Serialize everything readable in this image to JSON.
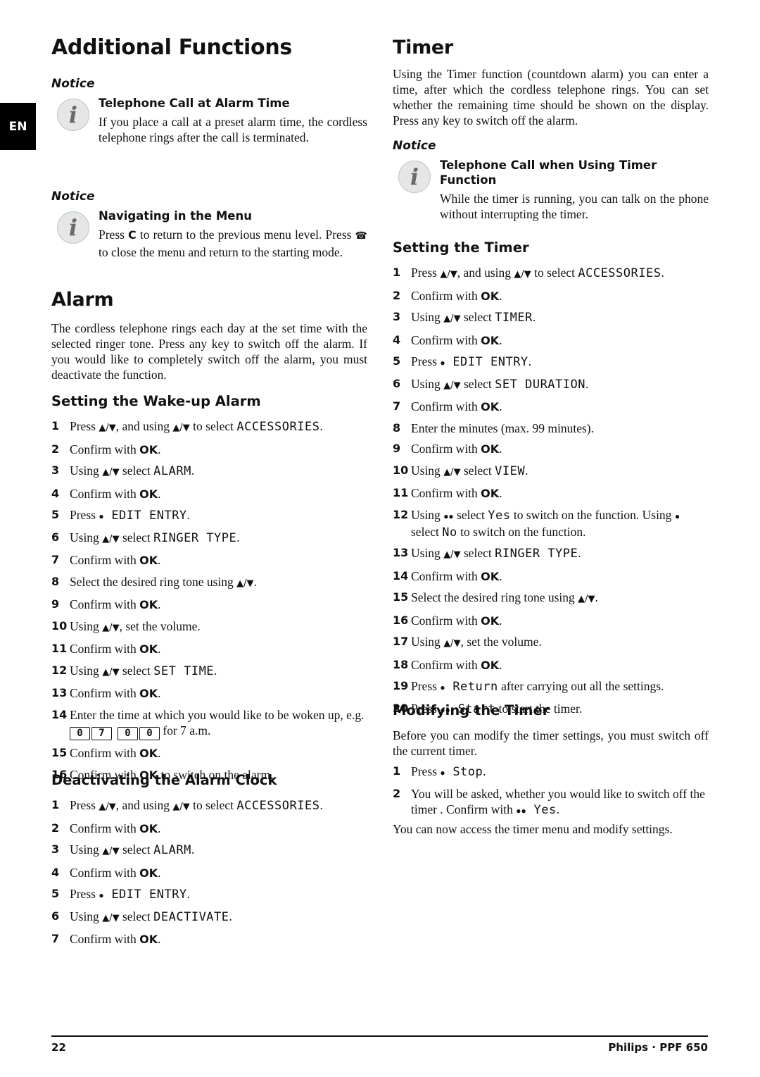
{
  "side_tab": "EN",
  "page_title": "Additional Functions",
  "notices_left": [
    {
      "label": "Notice",
      "title": "Telephone Call at Alarm Time",
      "text": "If you place a call at a preset alarm time, the cordless telephone rings after the call is terminated."
    },
    {
      "label": "Notice",
      "title": "Navigating in the Menu",
      "text_parts": [
        "Press ",
        "C",
        " to return to the previous menu level. Press ",
        "☎",
        " to close the menu and return to the starting mode."
      ]
    }
  ],
  "alarm": {
    "title": "Alarm",
    "intro": "The cordless telephone rings each day at the set time with the selected ringer tone. Press any key to switch off the alarm. If you would like to completely switch off the alarm, you must deactivate the function.",
    "wakeup": {
      "title": "Setting the Wake-up Alarm",
      "steps": [
        {
          "n": "1",
          "pre": "Press ",
          "nav": "▲/▼",
          "mid": ", and using ",
          "nav2": "▲/▼",
          "post": " to select ",
          "lcd": "ACCESSORIES",
          "end": "."
        },
        {
          "n": "2",
          "pre": " Confirm with ",
          "ok": "OK",
          "end": "."
        },
        {
          "n": "3",
          "pre": "Using ",
          "nav": "▲/▼",
          "post": " select ",
          "lcd": "ALARM",
          "end": "."
        },
        {
          "n": "4",
          "pre": "Confirm with ",
          "ok": "OK",
          "end": "."
        },
        {
          "n": "5",
          "pre": "Press ",
          "dot": "●",
          "lcd": " EDIT ENTRY",
          "end": "."
        },
        {
          "n": "6",
          "pre": "Using ",
          "nav": "▲/▼",
          "post": " select ",
          "lcd": "RINGER TYPE",
          "end": "."
        },
        {
          "n": "7",
          "pre": "Confirm with ",
          "ok": "OK",
          "end": "."
        },
        {
          "n": "8",
          "pre": "Select the desired ring tone using ",
          "nav": "▲/▼",
          "end": "."
        },
        {
          "n": "9",
          "pre": "Confirm with ",
          "ok": "OK",
          "end": "."
        },
        {
          "n": "10",
          "pre": "Using ",
          "nav": "▲/▼",
          "end": ", set the volume."
        },
        {
          "n": "11",
          "pre": "Confirm with ",
          "ok": "OK",
          "end": "."
        },
        {
          "n": "12",
          "pre": "Using ",
          "nav": "▲/▼",
          "post": " select ",
          "lcd": "SET TIME",
          "end": "."
        },
        {
          "n": "13",
          "pre": "Confirm with ",
          "ok": "OK",
          "end": "."
        },
        {
          "n": "14",
          "pre": "Enter the time at which you would like to be woken up, e.g. ",
          "keys": [
            "0",
            "7",
            "0",
            "0"
          ],
          "end": " for 7 a.m."
        },
        {
          "n": "15",
          "pre": "Confirm with ",
          "ok": "OK",
          "end": "."
        },
        {
          "n": "16",
          "pre": "Confirm with ",
          "ok": "OK",
          "end": " to switch on the alarm."
        }
      ]
    },
    "deactivate": {
      "title": "Deactivating the Alarm Clock",
      "steps": [
        {
          "n": "1",
          "pre": "Press ",
          "nav": "▲/▼",
          "mid": ", and using ",
          "nav2": "▲/▼",
          "post": " to select ",
          "lcd": "ACCESSORIES",
          "end": "."
        },
        {
          "n": "2",
          "pre": " Confirm with ",
          "ok": "OK",
          "end": "."
        },
        {
          "n": "3",
          "pre": "Using ",
          "nav": "▲/▼",
          "post": " select ",
          "lcd": "ALARM",
          "end": "."
        },
        {
          "n": "4",
          "pre": "Confirm with ",
          "ok": "OK",
          "end": "."
        },
        {
          "n": "5",
          "pre": "Press ",
          "dot": "●",
          "lcd": " EDIT ENTRY",
          "end": "."
        },
        {
          "n": "6",
          "pre": "Using ",
          "nav": "▲/▼",
          "post": " select ",
          "lcd": "DEACTIVATE",
          "end": "."
        },
        {
          "n": "7",
          "pre": "Confirm with ",
          "ok": "OK",
          "end": "."
        }
      ]
    }
  },
  "timer": {
    "title": "Timer",
    "intro": "Using the Timer function (countdown alarm) you can enter a time, after which the cordless telephone rings. You can set whether the remaining time should be shown on the display. Press any key to switch off the alarm.",
    "notice": {
      "label": "Notice",
      "title": "Telephone Call when Using Timer Function",
      "text": "While the timer is running, you can talk on the phone without interrupting the timer."
    },
    "setting": {
      "title": "Setting the Timer",
      "steps": [
        {
          "n": "1",
          "pre": "Press ",
          "nav": "▲/▼",
          "mid": ", and using ",
          "nav2": "▲/▼",
          "post": " to select ",
          "lcd": "ACCESSORIES",
          "end": "."
        },
        {
          "n": "2",
          "pre": " Confirm with ",
          "ok": "OK",
          "end": "."
        },
        {
          "n": "3",
          "pre": "Using ",
          "nav": "▲/▼",
          "post": " select ",
          "lcd": "TIMER",
          "end": "."
        },
        {
          "n": "4",
          "pre": "Confirm with ",
          "ok": "OK",
          "end": "."
        },
        {
          "n": "5",
          "pre": "Press ",
          "dot": "●",
          "lcd": " EDIT ENTRY",
          "end": "."
        },
        {
          "n": "6",
          "pre": "Using ",
          "nav": "▲/▼",
          "post": " select ",
          "lcd": "SET DURATION",
          "end": "."
        },
        {
          "n": "7",
          "pre": "Confirm with ",
          "ok": "OK",
          "end": "."
        },
        {
          "n": "8",
          "pre": "Enter the minutes (max. 99 minutes)."
        },
        {
          "n": "9",
          "pre": "Confirm with ",
          "ok": "OK",
          "end": "."
        },
        {
          "n": "10",
          "pre": "Using ",
          "nav": "▲/▼",
          "post": " select ",
          "lcd": "VIEW",
          "end": "."
        },
        {
          "n": "11",
          "pre": "Confirm with ",
          "ok": "OK",
          "end": "."
        },
        {
          "n": "12",
          "pre": "Using ",
          "dot": "●●",
          "post": " select ",
          "lcd": "Yes",
          "end": " to switch on the function. Using ",
          "dot2": "●",
          "post2": " select ",
          "lcd2": "No",
          "end2": " to switch on the function."
        },
        {
          "n": "13",
          "pre": "Using ",
          "nav": "▲/▼",
          "post": " select ",
          "lcd": "RINGER TYPE",
          "end": "."
        },
        {
          "n": "14",
          "pre": "Confirm with ",
          "ok": "OK",
          "end": "."
        },
        {
          "n": "15",
          "pre": "Select the desired ring tone using ",
          "nav": "▲/▼",
          "end": "."
        },
        {
          "n": "16",
          "pre": "Confirm with ",
          "ok": "OK",
          "end": "."
        },
        {
          "n": "17",
          "pre": "Using ",
          "nav": "▲/▼",
          "end": ", set the volume."
        },
        {
          "n": "18",
          "pre": "Confirm with ",
          "ok": "OK",
          "end": "."
        },
        {
          "n": "19",
          "pre": "Press ",
          "dot": "●",
          "lcd": " Return",
          "end": " after carrying out all the settings."
        },
        {
          "n": "20",
          "pre": "Press ",
          "dot": "●●",
          "lcd": " Start",
          "end": " to start the timer."
        }
      ]
    },
    "modifying": {
      "title": "Modifying the Timer",
      "intro": "Before you can modify the timer settings, you must switch off the current timer.",
      "steps": [
        {
          "n": "1",
          "pre": "Press ",
          "dot": "●",
          "lcd": " Stop",
          "end": "."
        },
        {
          "n": "2",
          "pre": "You will be asked, whether you would like to switch off the timer . Confirm with ",
          "dot": "●●",
          "lcd": " Yes",
          "end": "."
        }
      ],
      "outro": "You can now access the timer menu and modify settings."
    }
  },
  "footer": {
    "page_number": "22",
    "brand": "Philips · PPF 650"
  }
}
